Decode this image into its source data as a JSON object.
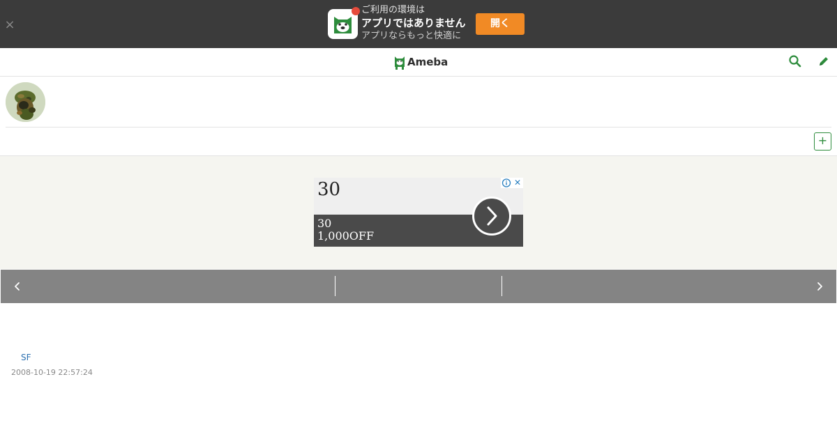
{
  "banner": {
    "close_label": "×",
    "line1": "ご利用の環境は",
    "line2": "アプリではありません",
    "line3": "アプリならもっと快適に",
    "open_label": "開く",
    "app_icon": "ameba-dog-icon",
    "accent_color": "#f18a25",
    "notify_color": "#e64b3c"
  },
  "header": {
    "logo_text": "Ameba",
    "brand_color": "#2d8c3c",
    "search_icon": "search-icon",
    "edit_icon": "pencil-icon"
  },
  "profile": {
    "avatar": "avatar-image"
  },
  "nav": {
    "plus_label": "+"
  },
  "ad": {
    "headline": "30",
    "line1": "30",
    "line2": "1,000OFF",
    "info_label": "ⓘ",
    "close_label": "✕"
  },
  "entry": {
    "tag": "SF",
    "date": "2008-10-19 22:57:24"
  }
}
